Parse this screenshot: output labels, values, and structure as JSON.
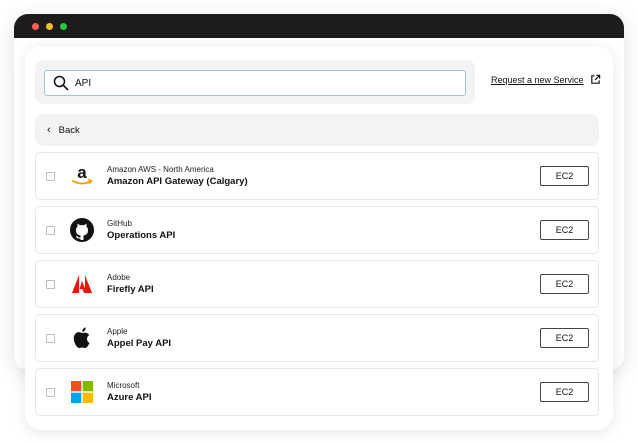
{
  "window": {
    "controls": [
      "close",
      "minimize",
      "maximize"
    ]
  },
  "search": {
    "value": "API",
    "placeholder": ""
  },
  "request_link": {
    "label": "Request a new Service",
    "icon": "external-link-icon"
  },
  "back": {
    "label": "Back",
    "icon": "chevron-left-icon"
  },
  "services": [
    {
      "provider": "Amazon AWS - North America",
      "name": "Amazon API Gateway (Calgary)",
      "tag": "EC2",
      "icon": "amazon-logo-icon",
      "checked": false
    },
    {
      "provider": "GitHub",
      "name": "Operations API",
      "tag": "EC2",
      "icon": "github-logo-icon",
      "checked": false
    },
    {
      "provider": "Adobe",
      "name": "Firefly API",
      "tag": "EC2",
      "icon": "adobe-logo-icon",
      "checked": false
    },
    {
      "provider": "Apple",
      "name": "Appel Pay API",
      "tag": "EC2",
      "icon": "apple-logo-icon",
      "checked": false
    },
    {
      "provider": "Microsoft",
      "name": "Azure API",
      "tag": "EC2",
      "icon": "microsoft-logo-icon",
      "checked": false
    }
  ],
  "colors": {
    "titlebar": "#1c1c1c",
    "search_border": "#9ec3dc",
    "adobe_red": "#fa0f00",
    "amazon_orange": "#ff9900"
  }
}
